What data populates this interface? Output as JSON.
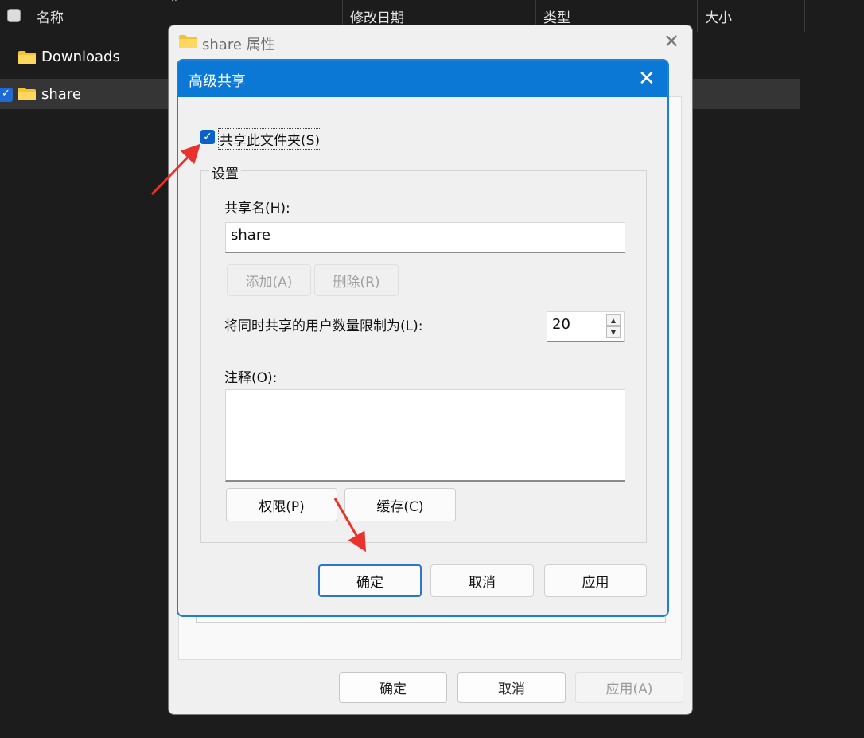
{
  "explorer": {
    "columns": {
      "name": "名称",
      "modified": "修改日期",
      "type": "类型",
      "size": "大小"
    },
    "rows": [
      {
        "name": "Downloads",
        "selected": false
      },
      {
        "name": "share",
        "selected": true
      }
    ]
  },
  "properties_dialog": {
    "title": "share 属性",
    "buttons": {
      "ok": "确定",
      "cancel": "取消",
      "apply": "应用(A)"
    }
  },
  "advanced_sharing": {
    "title": "高级共享",
    "share_checkbox": {
      "label": "共享此文件夹(S)",
      "checked": true
    },
    "settings_group": "设置",
    "share_name_label": "共享名(H):",
    "share_name_value": "share",
    "add_button": "添加(A)",
    "remove_button": "删除(R)",
    "user_limit_label": "将同时共享的用户数量限制为(L):",
    "user_limit_value": "20",
    "comment_label": "注释(O):",
    "comment_value": "",
    "permissions_button": "权限(P)",
    "caching_button": "缓存(C)",
    "ok_button": "确定",
    "cancel_button": "取消",
    "apply_button": "应用"
  },
  "colors": {
    "title_bar": "#0a78d4",
    "checkbox": "#0a62c9",
    "annotation_arrow": "#e8322b",
    "explorer_bg": "#1c1c1c"
  }
}
